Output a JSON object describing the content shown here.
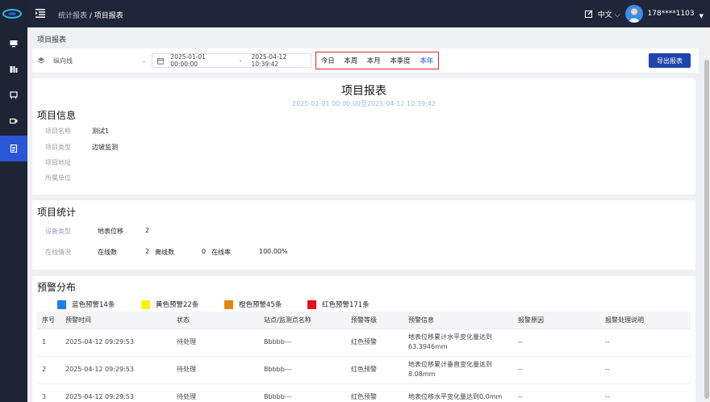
{
  "colors": {
    "sidebar": "#1d2434",
    "topbar": "#1f2639",
    "active": "#2a55d4",
    "export_btn": "#1e45a8",
    "highlight_border": "#e0252b"
  },
  "topbar": {
    "breadcrumb_parent": "统计报表",
    "breadcrumb_sep": " / ",
    "breadcrumb_current": "项目报表",
    "language": "中文",
    "username": "178****1103"
  },
  "sidebar": {
    "items": [
      {
        "icon": "monitor-icon",
        "active": false
      },
      {
        "icon": "dashboard-icon",
        "active": false
      },
      {
        "icon": "easel-icon",
        "active": false
      },
      {
        "icon": "camera-icon",
        "active": false
      },
      {
        "icon": "report-icon",
        "active": true
      }
    ]
  },
  "page_title": "项目报表",
  "filter": {
    "project": "纵向线",
    "start": "2025-01-01 00:00:00",
    "dash": "-",
    "end": "2025-04-12 10:39:42",
    "quick": [
      "今日",
      "本周",
      "本月",
      "本季度",
      "本年"
    ],
    "quick_selected": "本年",
    "export": "导出报表"
  },
  "report": {
    "title": "项目报表",
    "range": "2025-01-01 00:00:00至2025-04-12 10:39:42"
  },
  "project_info": {
    "title": "项目信息",
    "name_label": "项目名称",
    "name": "测试1",
    "type_label": "项目类型",
    "type": "边坡监测",
    "address_label": "项目地址",
    "unit_label": "所属单位"
  },
  "project_stats": {
    "title": "项目统计",
    "device_type_label": "设备类型",
    "device_type": "地表位移",
    "device_count": "2",
    "online_label": "在线情况",
    "online_label2": "在线数",
    "online": "2",
    "offline_label": "离线数",
    "offline": "0",
    "rate_label": "在线率",
    "rate": "100.00%"
  },
  "warning": {
    "title": "预警分布",
    "legend": [
      {
        "label": "蓝色预警14条",
        "color": "#1e7ef0"
      },
      {
        "label": "黄色预警22条",
        "color": "#f5f50a"
      },
      {
        "label": "橙色预警45条",
        "color": "#e8870e"
      },
      {
        "label": "红色预警171条",
        "color": "#e8101a"
      }
    ],
    "headers": [
      "序号",
      "预警时间",
      "状态",
      "站点/监测点名称",
      "预警等级",
      "预警信息",
      "报警原因",
      "报警处理说明"
    ],
    "rows": [
      [
        "1",
        "2025-04-12 09:29:53",
        "待处理",
        "Bbbbb---",
        "红色预警",
        "地表位移累计水平变化量达到63.3946mm",
        "--",
        "--"
      ],
      [
        "2",
        "2025-04-12 09:29:53",
        "待处理",
        "Bbbbb---",
        "红色预警",
        "地表位移累计垂直变化量达到8.08mm",
        "--",
        "--"
      ],
      [
        "3",
        "2025-04-12 09:29:53",
        "待处理",
        "Bbbbb---",
        "红色预警",
        "地表位移水平变化量达到0.0mm",
        "--",
        "--"
      ]
    ]
  }
}
